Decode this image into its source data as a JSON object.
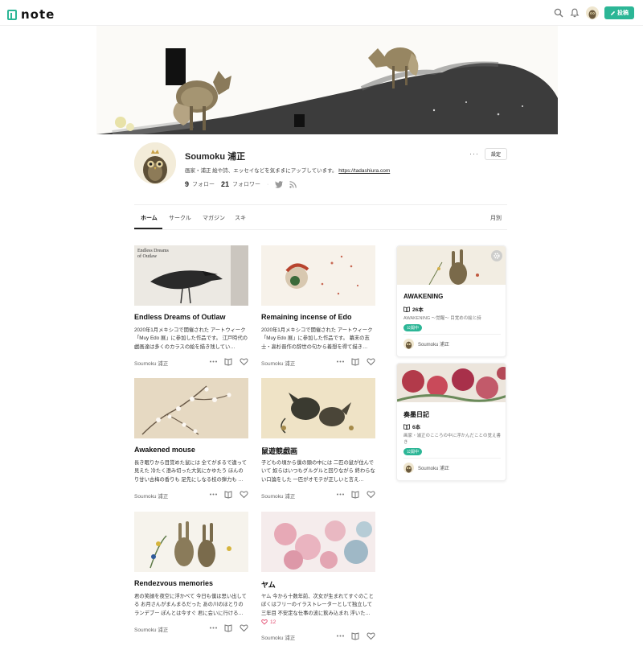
{
  "header": {
    "logo_text": "note",
    "search_icon": "search-icon",
    "bell_icon": "bell-icon",
    "post_label": "投稿",
    "accent": "#2cb696"
  },
  "profile": {
    "name": "Soumoku 浦正",
    "bio": "画家・浦正 絵や詩、エッセイなどを気ままにアップしています。",
    "bio_link": "https://tadashiura.com",
    "follows_count": "9",
    "follows_label": "フォロー",
    "followers_count": "21",
    "followers_label": "フォロワー",
    "more_label": "···",
    "settings_label": "設定"
  },
  "tabs": [
    {
      "label": "ホーム"
    },
    {
      "label": "サークル"
    },
    {
      "label": "マガジン"
    },
    {
      "label": "スキ"
    }
  ],
  "monthly_label": "月別",
  "articles": [
    {
      "title": "Endless Dreams of Outlaw",
      "excerpt": "2020年1月メキシコで開催された アートウィーク「Muy Edo 展」に参加した作品です。 江戸時代の戯画達は多くのカラスの絵を描き残してい…",
      "author": "Soumoku 浦正",
      "thumb_text": "Endless Dreams of Outlaw"
    },
    {
      "title": "Remaining incense of Edo",
      "excerpt": "2020年1月メキシコで開催された アートウィーク「Muy Edo 展」に参加した作品です。 幕末の志士・高杉晋作の辞世の句から着想を得て描き…",
      "author": "Soumoku 浦正"
    },
    {
      "title": "Awakened mouse",
      "excerpt": "長き眠りから目覚めた鼠には 全てがまるで違って見えた 冷たく澄み切った大気にかゆたう ほんのり甘い古梅の香りも 足先にしなる枝の弾力も …",
      "author": "Soumoku 浦正"
    },
    {
      "title": "鼠遊競戯画",
      "excerpt": "子どもの頃から僕の頭の中には 二匹の鼠が住んでいて 奴らはいつもグルグルと回りながら 終わらない口論をした 一匹がオモテが正しいと言え…",
      "author": "Soumoku 浦正"
    },
    {
      "title": "Rendezvous memories",
      "excerpt": "君の笑顔を夜空に浮かべて 今日も僕は思い出してる お月さんがまんまるだった あの川のほとりのランデブー ぽんとは今すぐ 君に会いに行ける…",
      "author": "Soumoku 浦正"
    },
    {
      "title": "ヤム",
      "excerpt": "ヤム 今から十数年前、次女が生まれてすぐのことぼくはフリーのイラストレーターとして独立して三年目 不安定な仕事の波に飲み込まれ 浮いた…",
      "author": "Soumoku 浦正",
      "likes": "12"
    }
  ],
  "magazines": [
    {
      "title": "AWAKENING",
      "count": "26本",
      "desc": "AWAKENING 〜覚醒〜 目覚めの絵と詩",
      "badge": "公開中",
      "author": "Soumoku 浦正"
    },
    {
      "title": "奏墨日記",
      "count": "6本",
      "desc": "画家・浦正のこころの中に浮かんだことの覚え書き",
      "badge": "公開中",
      "author": "Soumoku 浦正"
    }
  ]
}
